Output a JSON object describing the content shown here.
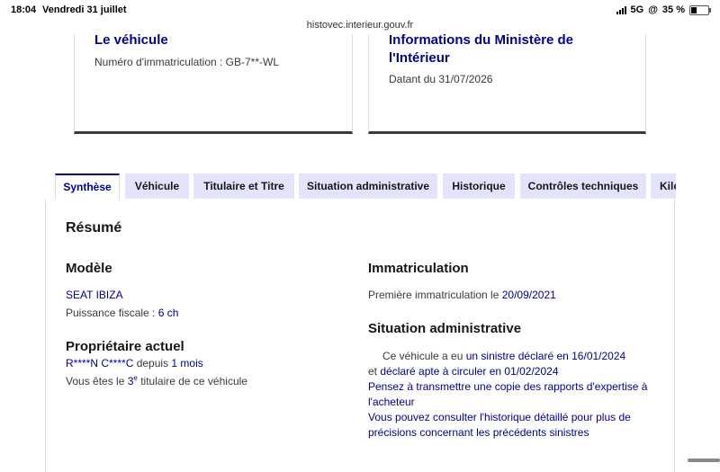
{
  "status": {
    "time": "18:04",
    "date": "Vendredi 31 juillet",
    "network": "5G",
    "battery": "35 %"
  },
  "browser": {
    "url": "histovec.interieur.gouv.fr"
  },
  "cards": {
    "vehicle": {
      "title": "Le véhicule",
      "text": "Numéro d'immatriculation : GB-7**-WL"
    },
    "ministry": {
      "title": "Informations du Ministère de l'Intérieur",
      "text": "Datant du 31/07/2026"
    }
  },
  "tabs": [
    "Synthèse",
    "Véhicule",
    "Titulaire et Titre",
    "Situation administrative",
    "Historique",
    "Contrôles techniques",
    "Kilo"
  ],
  "summary": {
    "title": "Résumé",
    "model": {
      "heading": "Modèle",
      "name": "SEAT IBIZA",
      "power_label": "Puissance fiscale :",
      "power_value": "6 ch"
    },
    "owner": {
      "heading": "Propriétaire actuel",
      "name": "R****N C****C",
      "since_label": "depuis",
      "since_value": "1 mois",
      "rank_prefix": "Vous êtes le",
      "rank_number": "3",
      "rank_sup": "e",
      "rank_suffix": "titulaire de ce véhicule"
    },
    "registration": {
      "heading": "Immatriculation",
      "label": "Première immatriculation le",
      "date": "20/09/2021"
    },
    "admin": {
      "heading": "Situation administrative",
      "line1_prefix": "Ce véhicule a eu",
      "line1_link": "un sinistre déclaré en 16/01/2024",
      "line2_prefix": "et",
      "line2_link": "déclaré apte à circuler en 01/02/2024",
      "line3a": "Pensez à transmettre une copie des rapports d'expertise à",
      "line3b": "l'acheteur",
      "line4a": "Vous pouvez consulter l'historique détaillé pour plus de",
      "line4b": "précisions concernant les précédents sinistres"
    }
  }
}
